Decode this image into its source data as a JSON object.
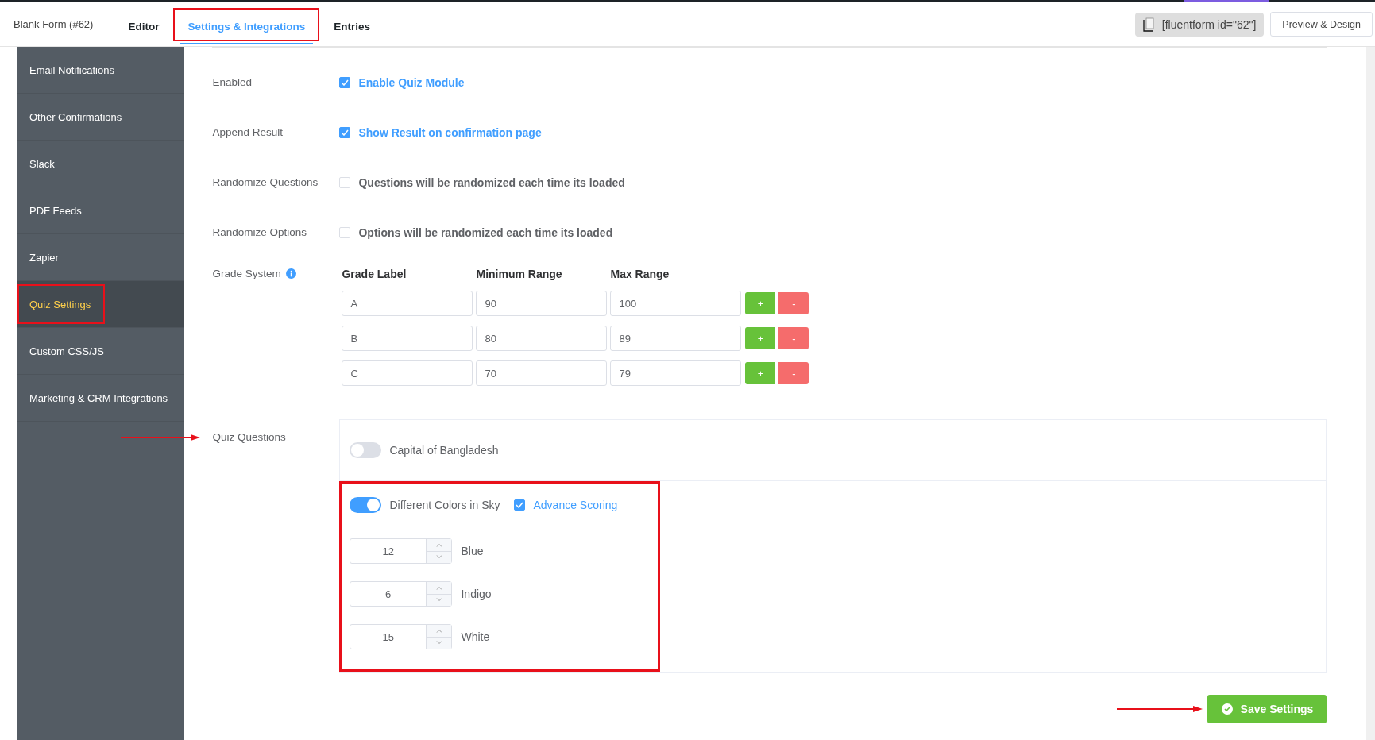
{
  "header": {
    "form_title": "Blank Form (#62)",
    "tabs": [
      {
        "label": "Editor",
        "selected": false,
        "highlighted": false
      },
      {
        "label": "Settings & Integrations",
        "selected": true,
        "highlighted": true
      },
      {
        "label": "Entries",
        "selected": false,
        "highlighted": false
      }
    ],
    "shortcode": "[fluentform id=\"62\"]",
    "preview_button": "Preview & Design"
  },
  "sidebar": {
    "items": [
      {
        "label": "Email Notifications",
        "selected": false,
        "highlighted": false
      },
      {
        "label": "Other Confirmations",
        "selected": false,
        "highlighted": false
      },
      {
        "label": "Slack",
        "selected": false,
        "highlighted": false
      },
      {
        "label": "PDF Feeds",
        "selected": false,
        "highlighted": false
      },
      {
        "label": "Zapier",
        "selected": false,
        "highlighted": false
      },
      {
        "label": "Quiz Settings",
        "selected": true,
        "highlighted": true
      },
      {
        "label": "Custom CSS/JS",
        "selected": false,
        "highlighted": false
      },
      {
        "label": "Marketing & CRM Integrations",
        "selected": false,
        "highlighted": false
      }
    ]
  },
  "settings": [
    {
      "label": "Enabled",
      "checked": true,
      "text": "Enable Quiz Module"
    },
    {
      "label": "Append Result",
      "checked": true,
      "text": "Show Result on confirmation page"
    },
    {
      "label": "Randomize Questions",
      "checked": false,
      "text": "Questions will be randomized each time its loaded"
    },
    {
      "label": "Randomize Options",
      "checked": false,
      "text": "Options will be randomized each time its loaded"
    }
  ],
  "grade_system": {
    "label": "Grade System",
    "columns": [
      "Grade Label",
      "Minimum Range",
      "Max Range"
    ],
    "rows": [
      {
        "grade": "A",
        "min": "90",
        "max": "100",
        "add": "+",
        "remove": "-"
      },
      {
        "grade": "B",
        "min": "80",
        "max": "89",
        "add": "+",
        "remove": "-"
      },
      {
        "grade": "C",
        "min": "70",
        "max": "79",
        "add": "+",
        "remove": "-"
      }
    ]
  },
  "quiz_questions": {
    "label": "Quiz Questions",
    "arrow": true,
    "questions": [
      {
        "title": "Capital of Bangladesh",
        "on": false,
        "highlighted": false
      },
      {
        "title": "Different Colors in Sky",
        "on": true,
        "highlighted": true,
        "advance_scoring": {
          "label": "Advance Scoring",
          "checked": true
        },
        "options": [
          {
            "score": "12",
            "label": "Blue"
          },
          {
            "score": "6",
            "label": "Indigo"
          },
          {
            "score": "15",
            "label": "White"
          }
        ]
      }
    ]
  },
  "save_button": {
    "label": "Save Settings",
    "arrow": true
  }
}
